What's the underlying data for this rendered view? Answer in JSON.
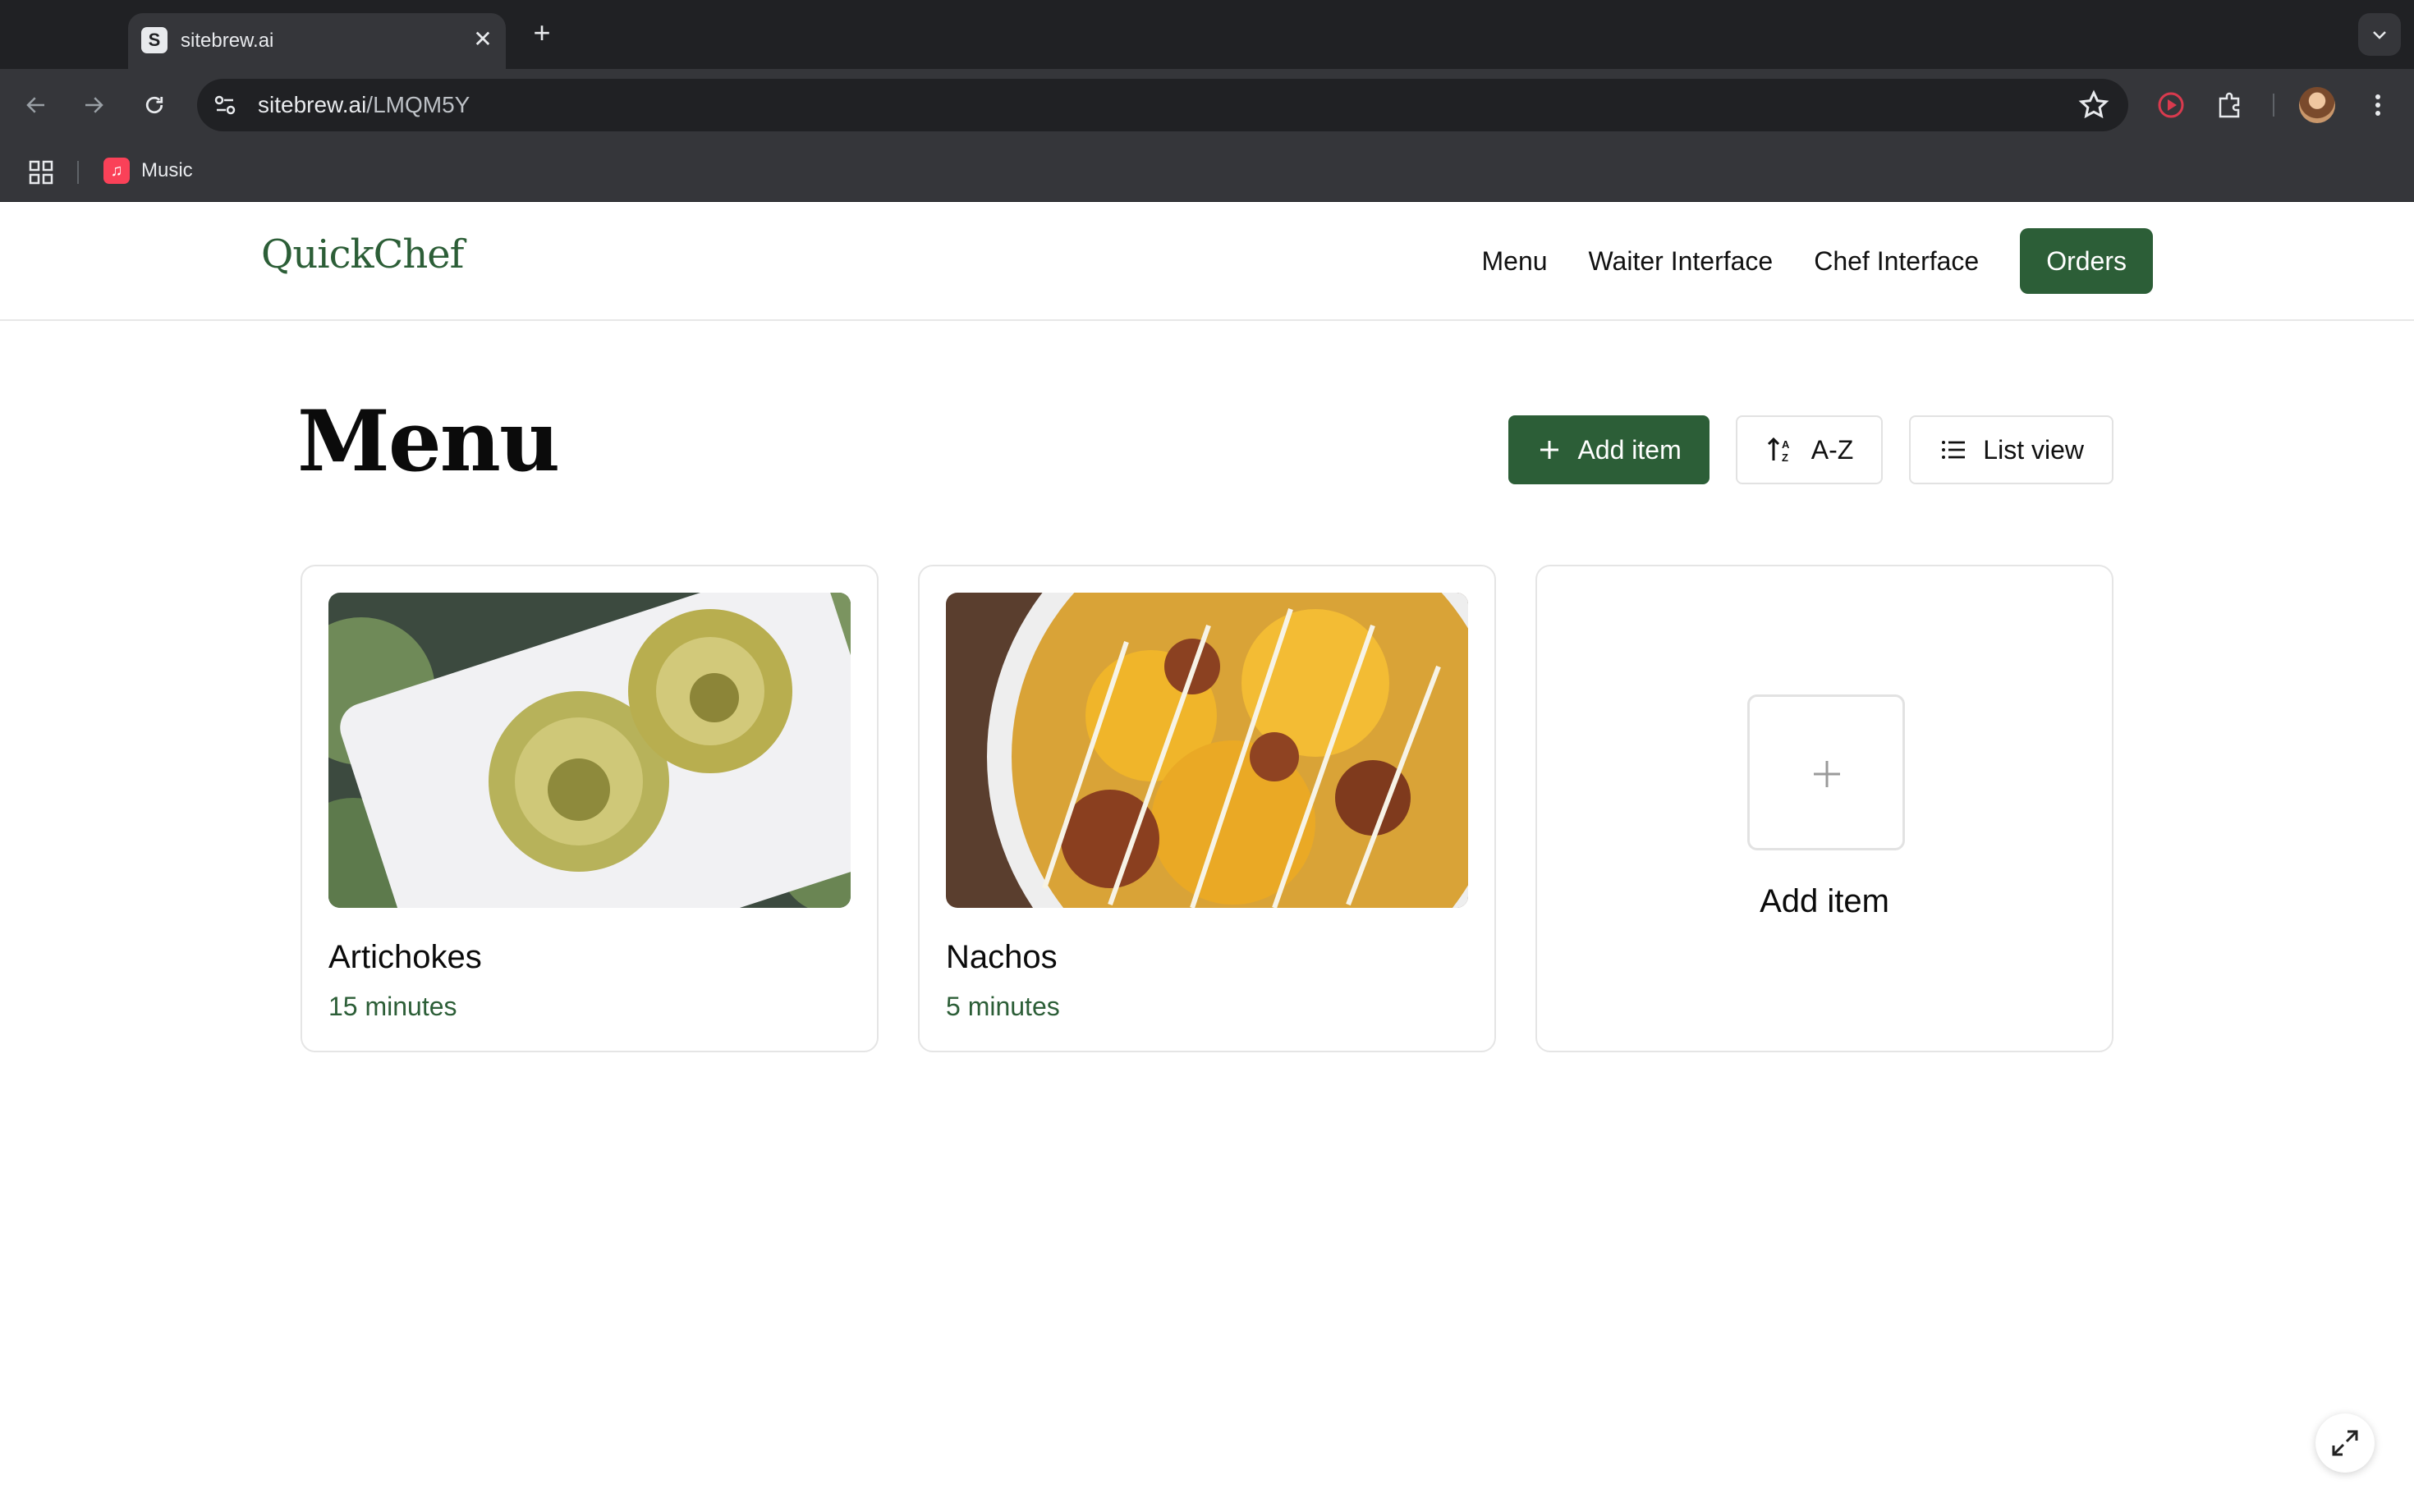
{
  "browser": {
    "tab_title": "sitebrew.ai",
    "tab_favicon_letter": "S",
    "tab_close": "✕",
    "new_tab": "+",
    "url_host": "sitebrew.ai",
    "url_path": "/LMQM5Y",
    "bookmarks": [
      {
        "label": "Music",
        "icon": "music-note-icon"
      }
    ]
  },
  "app": {
    "logo": "QuickChef",
    "nav": {
      "menu": "Menu",
      "waiter": "Waiter Interface",
      "chef": "Chef Interface",
      "orders": "Orders"
    }
  },
  "page": {
    "title": "Menu",
    "actions": {
      "add_item": "Add item",
      "sort": "A-Z",
      "view": "List view"
    }
  },
  "menu_items": [
    {
      "name": "Artichokes",
      "time": "15 minutes",
      "image": "artichokes-photo"
    },
    {
      "name": "Nachos",
      "time": "5 minutes",
      "image": "nachos-photo"
    }
  ],
  "add_card": {
    "label": "Add item"
  },
  "colors": {
    "brand_green": "#2c5e37",
    "browser_dark": "#202124",
    "browser_toolbar": "#35363a"
  }
}
